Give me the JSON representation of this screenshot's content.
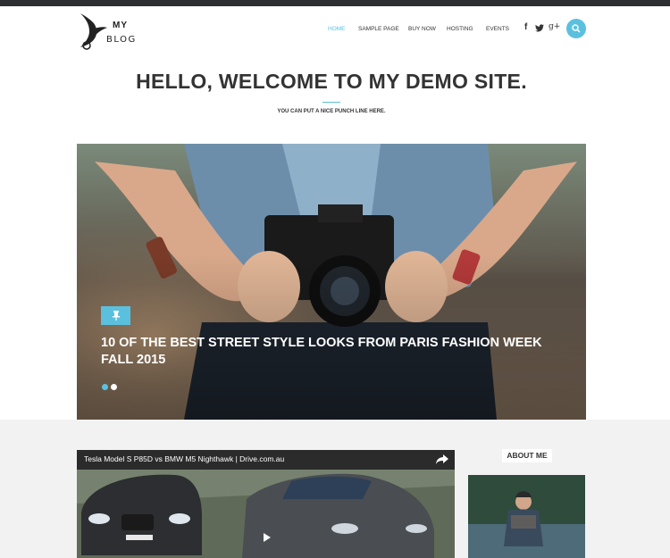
{
  "logo": {
    "line1": "MY",
    "line2": "BLOG"
  },
  "nav": {
    "items": [
      {
        "label": "HOME",
        "active": true
      },
      {
        "label": "SAMPLE PAGE",
        "active": false
      },
      {
        "label": "BUY NOW",
        "active": false
      },
      {
        "label": "HOSTING",
        "active": false
      },
      {
        "label": "EVENTS",
        "active": false
      }
    ],
    "social": [
      {
        "icon": "facebook-icon",
        "glyph": "f"
      },
      {
        "icon": "twitter-icon",
        "glyph": "🐦"
      },
      {
        "icon": "google-plus-icon",
        "glyph": "g+"
      }
    ],
    "search_icon": "search-icon"
  },
  "hero": {
    "title": "HELLO, WELCOME TO MY DEMO SITE.",
    "subtitle": "YOU CAN PUT A NICE PUNCH LINE HERE."
  },
  "slider": {
    "badge_icon": "pin-icon",
    "title": "10 OF THE BEST STREET STYLE LOOKS FROM PARIS FASHION WEEK FALL 2015",
    "dots": 2,
    "active_dot": 0
  },
  "video": {
    "title": "Tesla Model S P85D vs BMW M5 Nighthawk | Drive.com.au",
    "share_icon": "share-icon",
    "play_icon": "play-icon"
  },
  "sidebar": {
    "about_title": "ABOUT ME"
  },
  "colors": {
    "accent": "#5bc0de",
    "topbar": "#2d2f33",
    "lower_bg": "#f2f2f2"
  }
}
